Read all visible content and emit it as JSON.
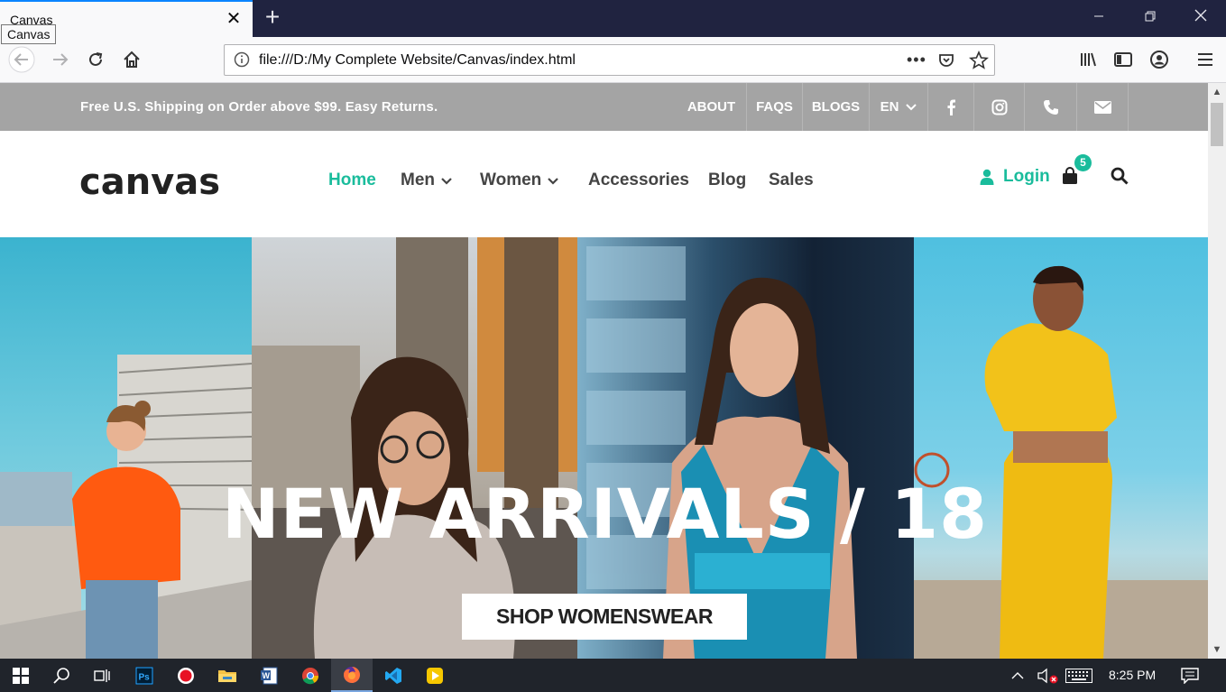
{
  "browser": {
    "tab_title": "Canvas",
    "tooltip": "Canvas",
    "url": "file:///D:/My Complete Website/Canvas/index.html",
    "accent": "#0a84ff"
  },
  "site": {
    "promo": "Free U.S. Shipping on Order above $99. Easy Returns.",
    "top_links": [
      "ABOUT",
      "FAQS",
      "BLOGS"
    ],
    "language": "EN",
    "logo": "canvas",
    "menu": [
      {
        "label": "Home",
        "active": true
      },
      {
        "label": "Men",
        "dropdown": true
      },
      {
        "label": "Women",
        "dropdown": true
      },
      {
        "label": "Accessories"
      },
      {
        "label": "Blog"
      },
      {
        "label": "Sales"
      }
    ],
    "login": "Login",
    "cart_count": "5",
    "accent": "#1abc9c"
  },
  "hero": {
    "title": "NEW ARRIVALS / 18",
    "button": "SHOP WOMENSWEAR"
  },
  "taskbar": {
    "time": "8:25 PM"
  }
}
